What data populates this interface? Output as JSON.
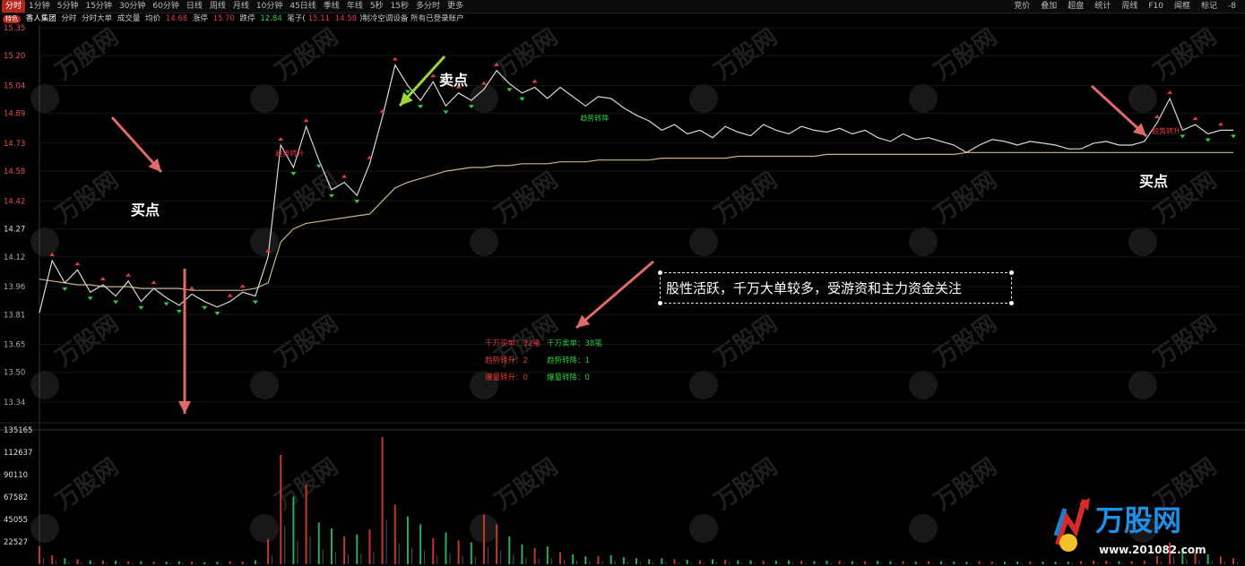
{
  "topbar": {
    "tabs": [
      "分时",
      "1分钟",
      "5分钟",
      "15分钟",
      "30分钟",
      "60分钟",
      "日线",
      "周线",
      "月线",
      "10分钟",
      "45日线",
      "季线",
      "年线",
      "5秒",
      "15秒",
      "多分时",
      "更多"
    ],
    "right": [
      "竞价",
      "叠加",
      "超盘",
      "统计",
      "周线",
      "F10",
      "闻框",
      "标记",
      "-8"
    ]
  },
  "infobar": {
    "badge": "特色",
    "name": "香人集团",
    "items": [
      "分时",
      "分时大单",
      "成交量",
      "均价"
    ],
    "avg_value": "14.68",
    "up_label": "涨停",
    "up_value": "15.70",
    "down_label": "跌停",
    "down_value": "12.84",
    "pen_label": "笔子(",
    "pen_v1": "15.11",
    "pen_v2": "14.58",
    "tail": ")制冷空调设备  所有已登录账户"
  },
  "colors": {
    "price_line": "#d8d8d8",
    "avg_line": "#c9b48a",
    "up": "#e03a3a",
    "down": "#2ecc40",
    "arrow": "#e06a6a",
    "arrow_green": "#9fd63a"
  },
  "annotations": {
    "buy1": "买点",
    "sell": "卖点",
    "buy2": "买点",
    "note": "股性活跃，千万大单较多，受游资和主力资金关注"
  },
  "stats": {
    "l1_label": "千万买单：",
    "l1_val": "32笔",
    "r1_label": "千万卖单：",
    "r1_val": "38笔",
    "l2_label": "趋势转升：",
    "l2_val": "2",
    "r2_label": "趋势转降：",
    "r2_val": "1",
    "l3_label": "爆量转升：",
    "l3_val": "0",
    "r3_label": "爆量转降：",
    "r3_val": "0"
  },
  "chart_markers": {
    "trend_up_1": "趋势转升",
    "trend_up_2": "趋势转升",
    "trend_down": "趋势转降"
  },
  "brand": {
    "name": "万股网",
    "url": "www.201082.com"
  },
  "chart_data": [
    {
      "type": "line",
      "title": "",
      "ylim": [
        13.34,
        15.35
      ],
      "yticks": [
        "15.35",
        "15.20",
        "15.04",
        "14.89",
        "14.73",
        "14.58",
        "14.42",
        "14.27",
        "14.12",
        "13.96",
        "13.81",
        "13.65",
        "13.50",
        "13.34"
      ],
      "series": [
        {
          "values": [
            13.82,
            14.1,
            13.98,
            14.05,
            13.93,
            13.97,
            13.91,
            13.99,
            13.88,
            13.95,
            13.9,
            13.86,
            13.92,
            13.88,
            13.85,
            13.88,
            13.93,
            13.91,
            14.12,
            14.72,
            14.6,
            14.82,
            14.64,
            14.48,
            14.52,
            14.45,
            14.62,
            14.87,
            15.15,
            15.04,
            14.96,
            15.06,
            14.93,
            15.0,
            14.96,
            15.02,
            15.12,
            15.05,
            15.0,
            15.03,
            14.97,
            15.03,
            14.98,
            14.93,
            14.98,
            14.97,
            14.92,
            14.88,
            14.85,
            14.8,
            14.83,
            14.78,
            14.8,
            14.76,
            14.82,
            14.79,
            14.77,
            14.83,
            14.8,
            14.78,
            14.82,
            14.8,
            14.79,
            14.81,
            14.78,
            14.8,
            14.76,
            14.74,
            14.78,
            14.75,
            14.76,
            14.74,
            14.72,
            14.68,
            14.72,
            14.75,
            14.74,
            14.72,
            14.74,
            14.73,
            14.72,
            14.7,
            14.7,
            14.73,
            14.74,
            14.72,
            14.72,
            14.74,
            14.84,
            14.97,
            14.8,
            14.83,
            14.78,
            14.8,
            14.8
          ]
        },
        {
          "values": [
            14.0,
            13.99,
            13.98,
            13.97,
            13.97,
            13.96,
            13.96,
            13.96,
            13.95,
            13.95,
            13.95,
            13.95,
            13.94,
            13.94,
            13.94,
            13.94,
            13.94,
            13.95,
            13.98,
            14.2,
            14.27,
            14.3,
            14.31,
            14.32,
            14.33,
            14.34,
            14.35,
            14.42,
            14.49,
            14.52,
            14.54,
            14.56,
            14.58,
            14.59,
            14.6,
            14.6,
            14.61,
            14.61,
            14.62,
            14.62,
            14.62,
            14.63,
            14.63,
            14.63,
            14.64,
            14.64,
            14.64,
            14.64,
            14.64,
            14.65,
            14.65,
            14.65,
            14.65,
            14.65,
            14.65,
            14.66,
            14.66,
            14.66,
            14.66,
            14.66,
            14.66,
            14.66,
            14.67,
            14.67,
            14.67,
            14.67,
            14.67,
            14.67,
            14.67,
            14.67,
            14.67,
            14.67,
            14.67,
            14.68,
            14.68,
            14.68,
            14.68,
            14.68,
            14.68,
            14.68,
            14.68,
            14.68,
            14.68,
            14.68,
            14.68,
            14.68,
            14.68,
            14.68,
            14.68,
            14.68,
            14.68,
            14.68,
            14.68,
            14.68,
            14.68
          ]
        }
      ]
    },
    {
      "type": "bar",
      "title": "",
      "ylim": [
        0,
        135165
      ],
      "yticks": [
        "135165",
        "112637",
        "90110",
        "67582",
        "45055",
        "22527"
      ],
      "values": [
        18000,
        9000,
        6000,
        5000,
        4000,
        4000,
        3500,
        3000,
        3000,
        2500,
        2500,
        3000,
        2500,
        2000,
        2500,
        3000,
        2500,
        4000,
        25000,
        110000,
        68000,
        80000,
        42000,
        36000,
        28000,
        30000,
        35000,
        128000,
        60000,
        48000,
        40000,
        26000,
        32000,
        24000,
        22000,
        50000,
        40000,
        28000,
        20000,
        16000,
        18000,
        12000,
        10000,
        8000,
        8000,
        9000,
        7000,
        6000,
        5000,
        6000,
        5000,
        4500,
        4000,
        5000,
        4500,
        4000,
        4000,
        3500,
        3500,
        4000,
        3500,
        3000,
        3500,
        3500,
        3000,
        3000,
        3500,
        3000,
        3000,
        2500,
        3000,
        3000,
        2500,
        2500,
        3000,
        2500,
        2500,
        2500,
        3000,
        2500,
        2500,
        2500,
        3000,
        3500,
        3500,
        3000,
        3000,
        3500,
        8000,
        22000,
        16000,
        12000,
        10000,
        8000,
        6000
      ]
    }
  ]
}
